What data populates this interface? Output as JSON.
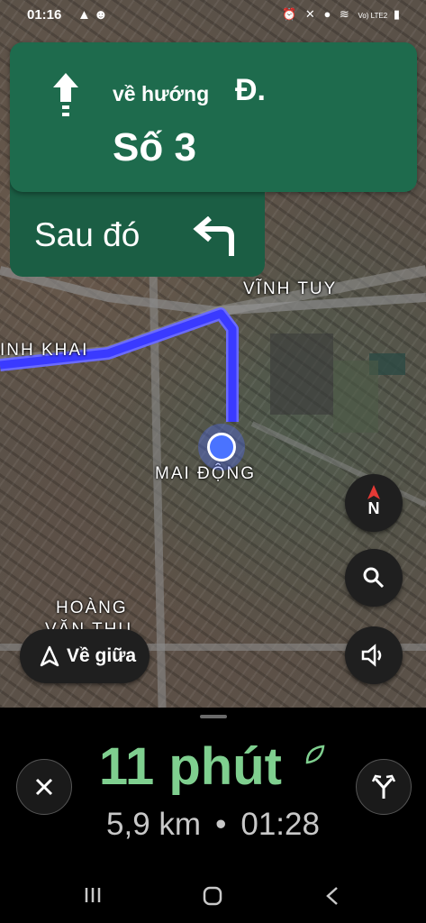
{
  "status_bar": {
    "time": "01:16",
    "icons": [
      "navigation-icon",
      "android-icon",
      "alarm-icon",
      "mute-icon",
      "location-icon",
      "wifi-icon",
      "lte-signal-icon",
      "battery-icon"
    ],
    "network_label": "Vo) LTE2"
  },
  "navigation": {
    "direction_icon": "arrow-up-icon",
    "toward_text": "về hướng",
    "road_prefix": "Đ.",
    "road_name": "Số 3",
    "then_label": "Sau đó",
    "then_icon": "turn-left-icon",
    "card_color": "#1e6b4d"
  },
  "map": {
    "labels": [
      "VĨNH TUY",
      "INH KHAI",
      "MAI ĐỘNG",
      "HOÀNG",
      "VĂN THỤ",
      "N"
    ],
    "route_color": "#3a3aff",
    "location_color": "#4a73ff"
  },
  "map_controls": {
    "compass_label": "N",
    "search_icon": "search-icon",
    "sound_icon": "volume-icon",
    "recenter_label": "Về giữa",
    "recenter_icon": "navigation-arrow-icon"
  },
  "trip": {
    "duration": "11 phút",
    "eco_icon": "leaf-icon",
    "distance": "5,9 km",
    "separator": "•",
    "arrival_time": "01:28",
    "eta_color": "#7fcf8f"
  },
  "buttons": {
    "close_icon": "close-icon",
    "alt_routes_icon": "route-fork-icon"
  },
  "system_nav": [
    "recents-icon",
    "home-icon",
    "back-icon"
  ]
}
